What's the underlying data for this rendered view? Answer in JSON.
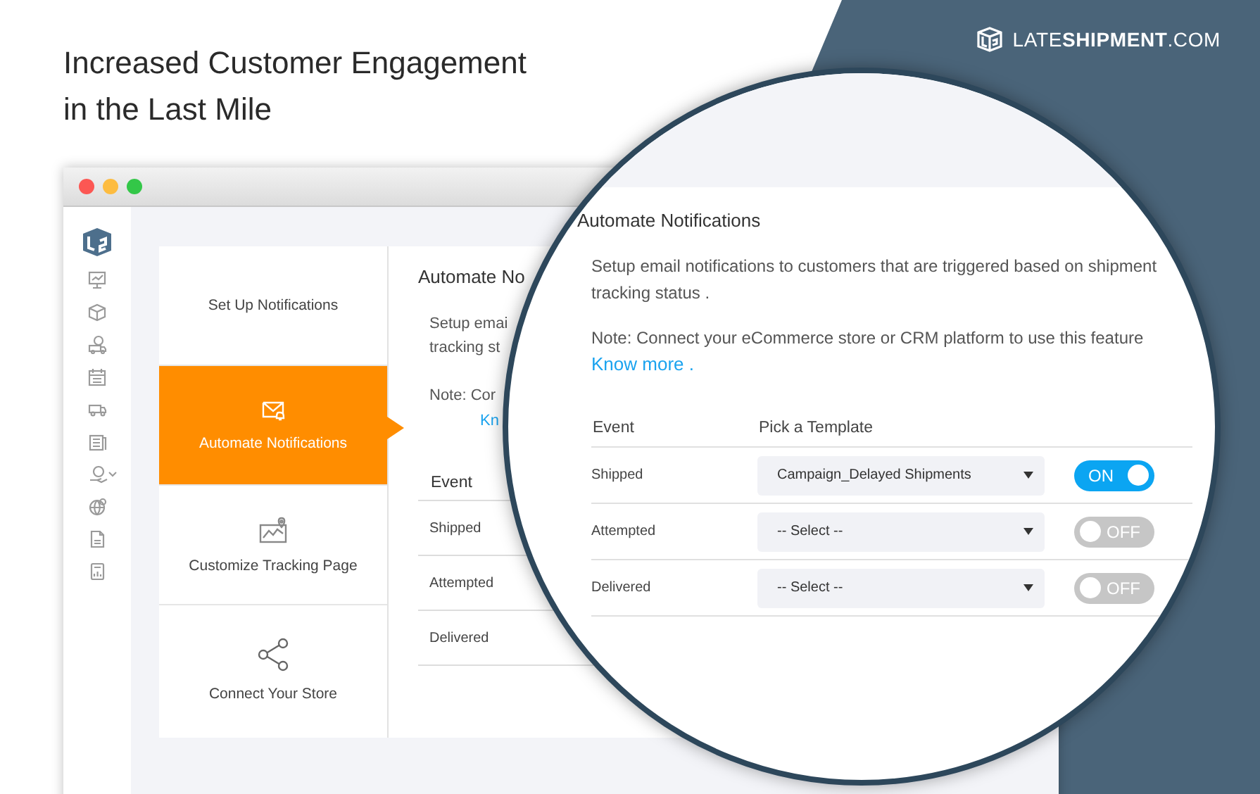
{
  "headline_lines": [
    "Increased Customer Engagement",
    "in the Last Mile"
  ],
  "brand": {
    "name": "LATE**SHIPMENT**.COM"
  },
  "app_window": {
    "nav": [
      {
        "label": "Set Up Notifications",
        "selected": false
      },
      {
        "label": "Automate Notifications",
        "selected": true
      },
      {
        "label": "Customize Tracking Page",
        "selected": false
      },
      {
        "label": "Connect Your Store",
        "selected": false
      }
    ],
    "panel": {
      "title": "Automate No",
      "description_lines": [
        "Setup emai",
        "tracking st"
      ],
      "note": "Note: Cor",
      "link": "Kn",
      "column": "Event",
      "rows": [
        "Shipped",
        "Attempted",
        "Delivered"
      ]
    }
  },
  "zoom": {
    "title": "Automate Notifications",
    "description": "Setup email notifications to customers that are triggered based on shipment tracking status .",
    "note": "Note: Connect your eCommerce store or CRM platform to use this feature",
    "link": "Know more .",
    "columns": [
      "Event",
      "Pick a Template"
    ],
    "rows": [
      {
        "event": "Shipped",
        "template": "Campaign_Delayed Shipments",
        "toggle": {
          "label": "ON",
          "on": true
        }
      },
      {
        "event": "Attempted",
        "template": "-- Select --",
        "toggle": {
          "label": "OFF",
          "on": false
        }
      },
      {
        "event": "Delivered",
        "template": "-- Select --",
        "toggle": {
          "label": "OFF",
          "on": false
        }
      }
    ]
  }
}
